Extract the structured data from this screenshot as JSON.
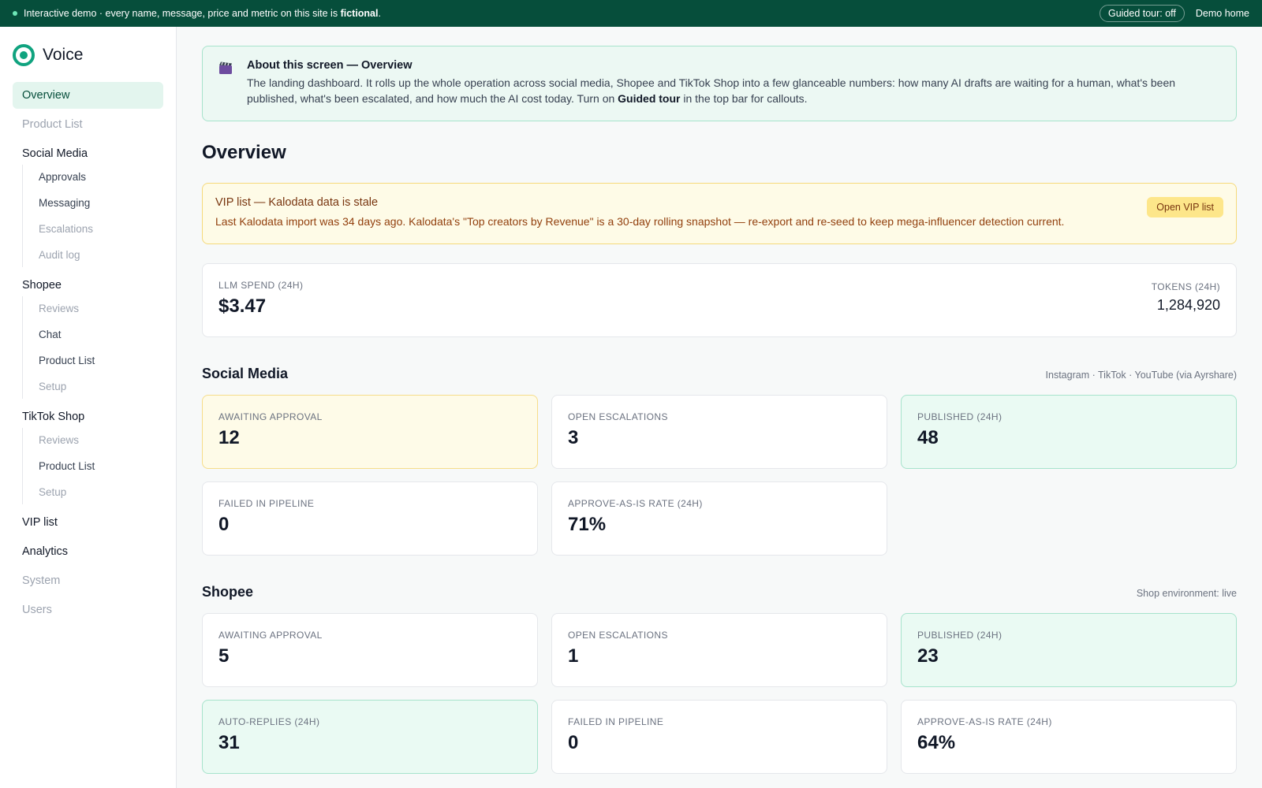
{
  "banner": {
    "text": "Interactive demo · every name, message, price and metric on this site is ",
    "emphasis": "fictional",
    "suffix": ".",
    "tour_label": "Guided tour: off",
    "demo_home": "Demo home"
  },
  "brand": {
    "name": "Voice"
  },
  "sidebar": {
    "overview": "Overview",
    "product_list": "Product List",
    "social_media": {
      "label": "Social Media",
      "items": [
        "Approvals",
        "Messaging",
        "Escalations",
        "Audit log"
      ]
    },
    "shopee": {
      "label": "Shopee",
      "items": [
        "Reviews",
        "Chat",
        "Product List",
        "Setup"
      ]
    },
    "tiktok": {
      "label": "TikTok Shop",
      "items": [
        "Reviews",
        "Product List",
        "Setup"
      ]
    },
    "vip_list": "VIP list",
    "analytics": "Analytics",
    "system": "System",
    "users": "Users"
  },
  "about": {
    "title": "About this screen — Overview",
    "text": "The landing dashboard. It rolls up the whole operation across social media, Shopee and TikTok Shop into a few glanceable numbers: how many AI drafts are waiting for a human, what's been published, what's been escalated, and how much the AI cost today. Turn on ",
    "bold": "Guided tour",
    "suffix": " in the top bar for callouts."
  },
  "page_title": "Overview",
  "stale": {
    "title": "VIP list — Kalodata data is stale",
    "text": "Last Kalodata import was 34 days ago. Kalodata's \"Top creators by Revenue\" is a 30-day rolling snapshot — re-export and re-seed to keep mega-influencer detection current.",
    "button": "Open VIP list"
  },
  "spend": {
    "label": "LLM SPEND (24H)",
    "value": "$3.47",
    "tokens_label": "TOKENS (24H)",
    "tokens_value": "1,284,920"
  },
  "social": {
    "title": "Social Media",
    "meta": "Instagram · TikTok · YouTube (via Ayrshare)",
    "cards": [
      {
        "label": "AWAITING APPROVAL",
        "value": "12"
      },
      {
        "label": "OPEN ESCALATIONS",
        "value": "3"
      },
      {
        "label": "PUBLISHED (24H)",
        "value": "48"
      },
      {
        "label": "FAILED IN PIPELINE",
        "value": "0"
      },
      {
        "label": "APPROVE-AS-IS RATE (24H)",
        "value": "71%"
      }
    ]
  },
  "shopee": {
    "title": "Shopee",
    "meta": "Shop environment: live",
    "cards": [
      {
        "label": "AWAITING APPROVAL",
        "value": "5"
      },
      {
        "label": "OPEN ESCALATIONS",
        "value": "1"
      },
      {
        "label": "PUBLISHED (24H)",
        "value": "23"
      },
      {
        "label": "AUTO-REPLIES (24H)",
        "value": "31"
      },
      {
        "label": "FAILED IN PIPELINE",
        "value": "0"
      },
      {
        "label": "APPROVE-AS-IS RATE (24H)",
        "value": "64%"
      }
    ]
  },
  "colors": {
    "brand": "#10a37f",
    "banner": "#064e3b",
    "warn": "#fefbe8",
    "good": "#eafaf3"
  }
}
